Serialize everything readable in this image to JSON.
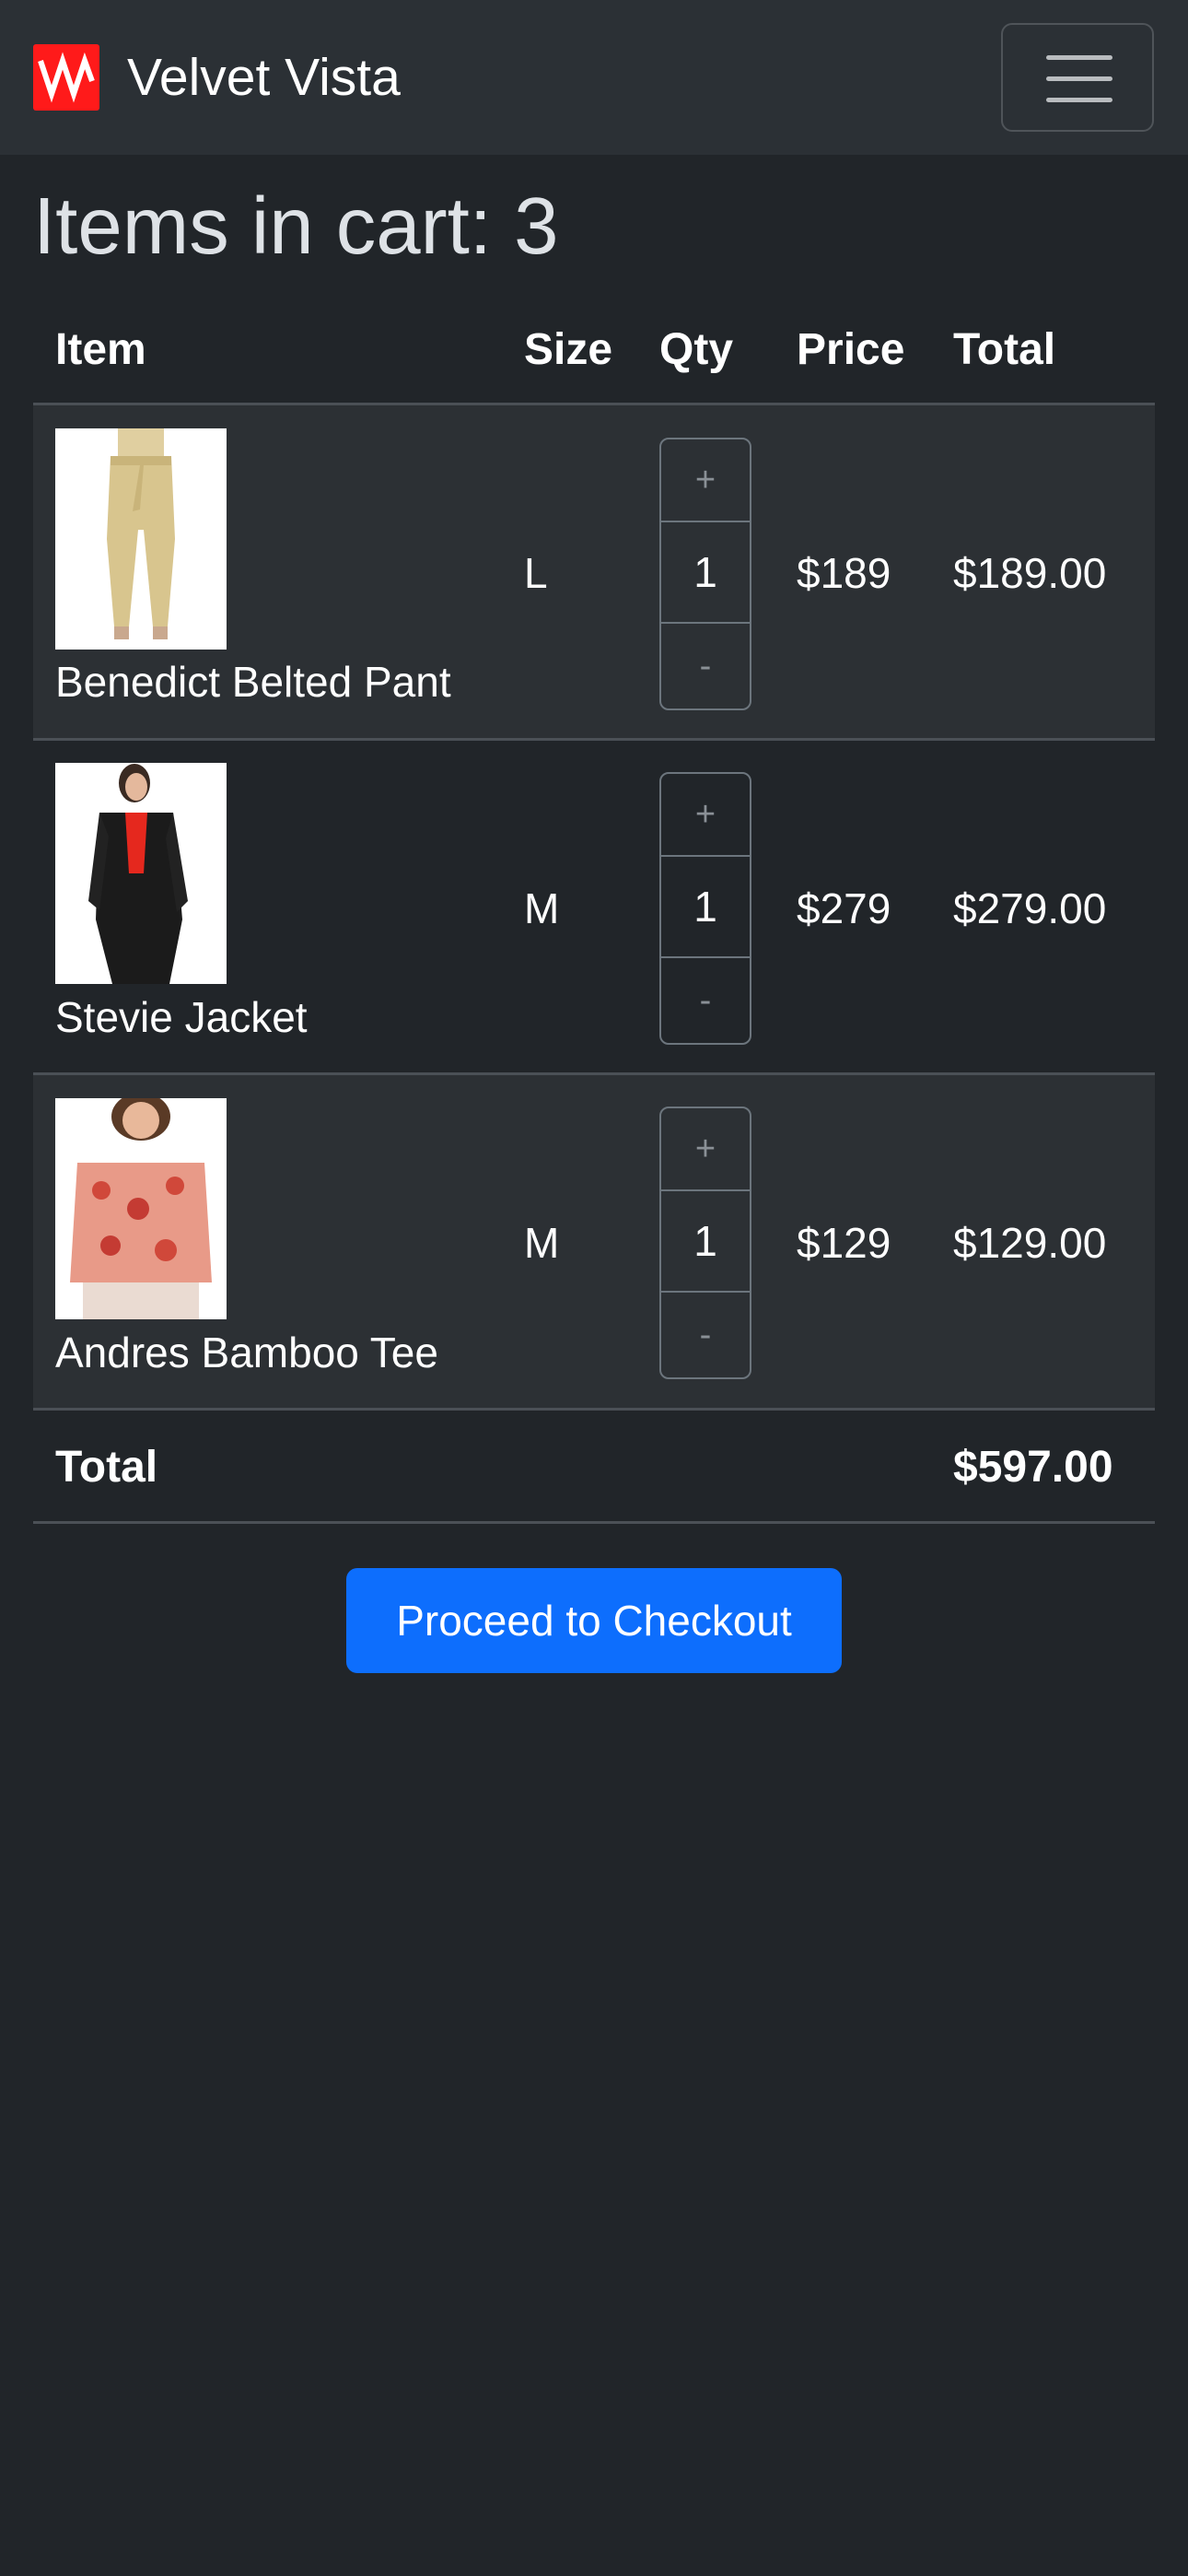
{
  "navbar": {
    "brand_name": "Velvet Vista",
    "logo_icon": "vv-logo-icon",
    "menu_icon": "hamburger-menu-icon"
  },
  "cart": {
    "heading": "Items in cart: 3",
    "headers": {
      "item": "Item",
      "size": "Size",
      "qty": "Qty",
      "price": "Price",
      "total": "Total"
    },
    "items": [
      {
        "name": "Benedict Belted Pant",
        "size": "L",
        "qty": "1",
        "price": "$189",
        "total": "$189.00",
        "plus": "+",
        "minus": "-"
      },
      {
        "name": "Stevie Jacket",
        "size": "M",
        "qty": "1",
        "price": "$279",
        "total": "$279.00",
        "plus": "+",
        "minus": "-"
      },
      {
        "name": "Andres Bamboo Tee",
        "size": "M",
        "qty": "1",
        "price": "$129",
        "total": "$129.00",
        "plus": "+",
        "minus": "-"
      }
    ],
    "total_label": "Total",
    "total_value": "$597.00",
    "checkout_label": "Proceed to Checkout"
  },
  "colors": {
    "background": "#212529",
    "navbar": "#2b3035",
    "row_stripe": "#2c3034",
    "accent": "#0d6efd",
    "logo": "#ff1a1a"
  }
}
